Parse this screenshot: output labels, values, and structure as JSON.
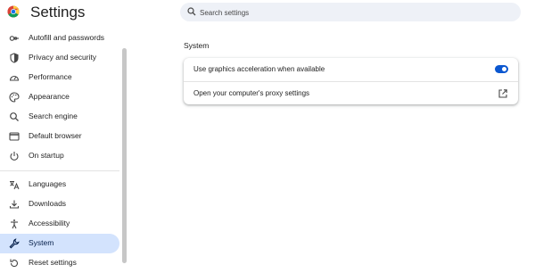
{
  "app": {
    "title": "Settings",
    "logo_icon": "chrome-logo-icon"
  },
  "search": {
    "placeholder": "Search settings",
    "value": ""
  },
  "sidebar": {
    "items": [
      {
        "id": "autofill",
        "label": "Autofill and passwords",
        "icon": "key-icon",
        "active": false
      },
      {
        "id": "privacy",
        "label": "Privacy and security",
        "icon": "shield-icon",
        "active": false
      },
      {
        "id": "performance",
        "label": "Performance",
        "icon": "speedometer-icon",
        "active": false
      },
      {
        "id": "appearance",
        "label": "Appearance",
        "icon": "palette-icon",
        "active": false
      },
      {
        "id": "search-engine",
        "label": "Search engine",
        "icon": "search-icon",
        "active": false
      },
      {
        "id": "default-browser",
        "label": "Default browser",
        "icon": "browser-window-icon",
        "active": false
      },
      {
        "id": "on-startup",
        "label": "On startup",
        "icon": "power-icon",
        "active": false
      },
      {
        "id": "languages",
        "label": "Languages",
        "icon": "translate-icon",
        "active": false
      },
      {
        "id": "downloads",
        "label": "Downloads",
        "icon": "download-icon",
        "active": false
      },
      {
        "id": "accessibility",
        "label": "Accessibility",
        "icon": "accessibility-icon",
        "active": false
      },
      {
        "id": "system",
        "label": "System",
        "icon": "wrench-icon",
        "active": true
      },
      {
        "id": "reset",
        "label": "Reset settings",
        "icon": "reset-icon",
        "active": false
      }
    ]
  },
  "main": {
    "section_title": "System",
    "rows": [
      {
        "label": "Use graphics acceleration when available",
        "control": "toggle",
        "checked": true
      },
      {
        "label": "Open your computer's proxy settings",
        "control": "external-link"
      }
    ]
  },
  "colors": {
    "accent": "#0b57d0",
    "active_bg": "#d3e3fd",
    "search_bg": "#eef1f7"
  }
}
